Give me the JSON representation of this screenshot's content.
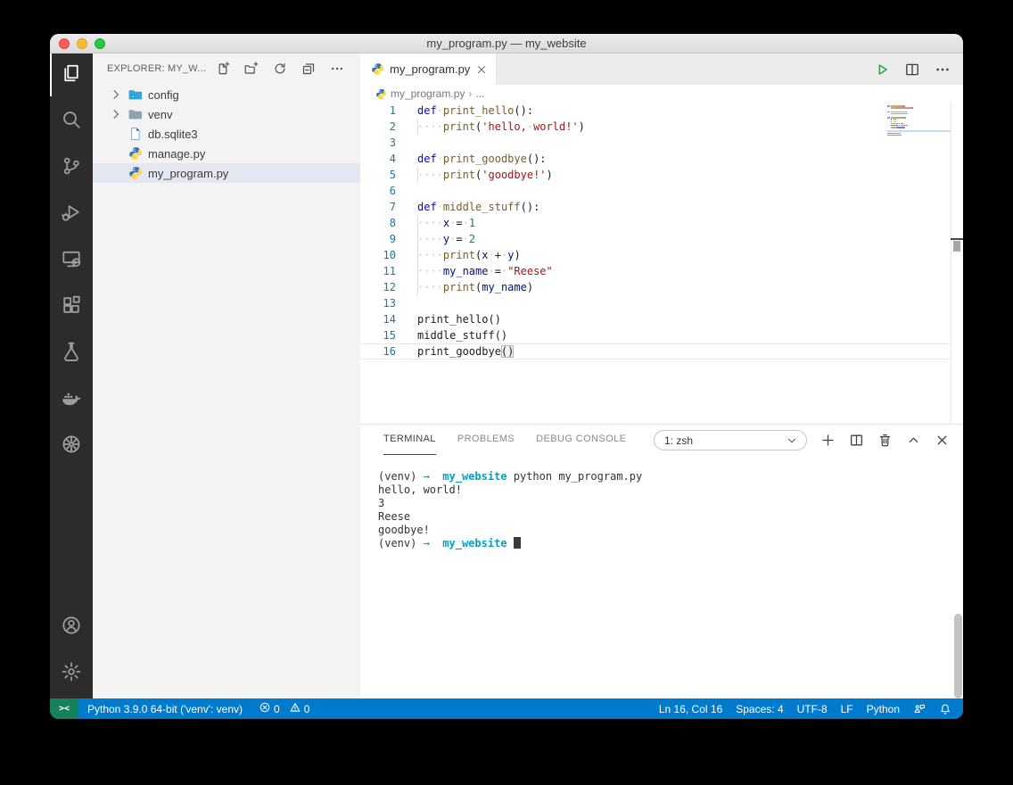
{
  "window": {
    "title": "my_program.py — my_website"
  },
  "colors": {
    "accent": "#007ACC",
    "remote": "#16825D",
    "kw": "#0000FF",
    "fn": "#795E26",
    "st": "#A31515",
    "nm": "#098658",
    "vr": "#001080",
    "line-number": "#237893",
    "tdir": "#00A2C7",
    "tarrow": "#23A923"
  },
  "activity_bar": {
    "top": [
      {
        "name": "explorer",
        "icon": "files",
        "active": true
      },
      {
        "name": "search",
        "icon": "search"
      },
      {
        "name": "source-control",
        "icon": "source-control"
      },
      {
        "name": "run-debug",
        "icon": "run-debug"
      },
      {
        "name": "remote-explorer",
        "icon": "remote-explorer"
      },
      {
        "name": "extensions",
        "icon": "extensions"
      },
      {
        "name": "testing",
        "icon": "testing"
      },
      {
        "name": "docker",
        "icon": "docker"
      },
      {
        "name": "kubernetes",
        "icon": "kubernetes"
      }
    ],
    "bottom": [
      {
        "name": "account",
        "icon": "account"
      },
      {
        "name": "settings",
        "icon": "settings"
      }
    ]
  },
  "sidebar": {
    "header": "EXPLORER: MY_W...",
    "actions": [
      {
        "name": "new-file",
        "icon": "new-file"
      },
      {
        "name": "new-folder",
        "icon": "new-folder"
      },
      {
        "name": "refresh-explorer",
        "icon": "refresh"
      },
      {
        "name": "collapse-folders",
        "icon": "collapse-all"
      },
      {
        "name": "more-actions",
        "icon": "more"
      }
    ],
    "files": [
      {
        "label": "config",
        "icon": "folder-config",
        "chevron": true
      },
      {
        "label": "venv",
        "icon": "folder",
        "chevron": true
      },
      {
        "label": "db.sqlite3",
        "icon": "file-db",
        "chevron": false
      },
      {
        "label": "manage.py",
        "icon": "python",
        "chevron": false
      },
      {
        "label": "my_program.py",
        "icon": "python",
        "chevron": false,
        "selected": true
      }
    ]
  },
  "editor": {
    "tab": {
      "label": "my_program.py"
    },
    "actions": [
      {
        "name": "run-python-file",
        "icon": "run",
        "cls": "run"
      },
      {
        "name": "split-editor",
        "icon": "split",
        "cls": ""
      },
      {
        "name": "more-actions",
        "icon": "more",
        "cls": ""
      }
    ],
    "breadcrumb": {
      "file": "my_program.py",
      "separator": "›",
      "more": "..."
    },
    "code": {
      "lines": [
        {
          "num": "1",
          "tokens": [
            [
              "kw",
              "def"
            ],
            [
              "ws",
              " "
            ],
            [
              "fn",
              "print_hello"
            ],
            [
              "pn",
              "():"
            ]
          ]
        },
        {
          "num": "2",
          "indent": true,
          "tokens": [
            [
              "ws",
              "    "
            ],
            [
              "fn",
              "print"
            ],
            [
              "pn",
              "("
            ],
            [
              "st",
              "'hello, world!'"
            ],
            [
              "pn",
              ")"
            ]
          ]
        },
        {
          "num": "3",
          "tokens": []
        },
        {
          "num": "4",
          "tokens": [
            [
              "kw",
              "def"
            ],
            [
              "ws",
              " "
            ],
            [
              "fn",
              "print_goodbye"
            ],
            [
              "pn",
              "():"
            ]
          ]
        },
        {
          "num": "5",
          "indent": true,
          "tokens": [
            [
              "ws",
              "    "
            ],
            [
              "fn",
              "print"
            ],
            [
              "pn",
              "("
            ],
            [
              "st",
              "'goodbye!'"
            ],
            [
              "pn",
              ")"
            ]
          ]
        },
        {
          "num": "6",
          "tokens": []
        },
        {
          "num": "7",
          "tokens": [
            [
              "kw",
              "def"
            ],
            [
              "ws",
              " "
            ],
            [
              "fn",
              "middle_stuff"
            ],
            [
              "pn",
              "():"
            ]
          ]
        },
        {
          "num": "8",
          "indent": true,
          "tokens": [
            [
              "ws",
              "    "
            ],
            [
              "vr",
              "x"
            ],
            [
              "ws",
              " "
            ],
            [
              "pn",
              "="
            ],
            [
              "ws",
              " "
            ],
            [
              "nm",
              "1"
            ]
          ]
        },
        {
          "num": "9",
          "indent": true,
          "tokens": [
            [
              "ws",
              "    "
            ],
            [
              "vr",
              "y"
            ],
            [
              "ws",
              " "
            ],
            [
              "pn",
              "="
            ],
            [
              "ws",
              " "
            ],
            [
              "nm",
              "2"
            ]
          ]
        },
        {
          "num": "10",
          "indent": true,
          "tokens": [
            [
              "ws",
              "    "
            ],
            [
              "fn",
              "print"
            ],
            [
              "pn",
              "("
            ],
            [
              "vr",
              "x"
            ],
            [
              "ws",
              " "
            ],
            [
              "pn",
              "+"
            ],
            [
              "ws",
              " "
            ],
            [
              "vr",
              "y"
            ],
            [
              "pn",
              ")"
            ]
          ]
        },
        {
          "num": "11",
          "indent": true,
          "tokens": [
            [
              "ws",
              "    "
            ],
            [
              "vr",
              "my_name"
            ],
            [
              "ws",
              " "
            ],
            [
              "pn",
              "="
            ],
            [
              "ws",
              " "
            ],
            [
              "st",
              "\"Reese\""
            ]
          ]
        },
        {
          "num": "12",
          "indent": true,
          "tokens": [
            [
              "ws",
              "    "
            ],
            [
              "fn",
              "print"
            ],
            [
              "pn",
              "("
            ],
            [
              "vr",
              "my_name"
            ],
            [
              "pn",
              ")"
            ]
          ]
        },
        {
          "num": "13",
          "tokens": []
        },
        {
          "num": "14",
          "tokens": [
            [
              "pl",
              "print_hello"
            ],
            [
              "pn",
              "()"
            ]
          ]
        },
        {
          "num": "15",
          "tokens": [
            [
              "pl",
              "middle_stuff"
            ],
            [
              "pn",
              "()"
            ]
          ]
        },
        {
          "num": "16",
          "current": true,
          "tokens": [
            [
              "pl",
              "print_goodbye"
            ],
            [
              "br",
              "()"
            ]
          ]
        }
      ]
    }
  },
  "panel": {
    "tabs": [
      {
        "label": "TERMINAL",
        "active": true
      },
      {
        "label": "PROBLEMS",
        "active": false
      },
      {
        "label": "DEBUG CONSOLE",
        "active": false
      }
    ],
    "terminal_select": "1: zsh",
    "actions": [
      {
        "name": "new-terminal",
        "icon": "plus"
      },
      {
        "name": "split-terminal",
        "icon": "split"
      },
      {
        "name": "kill-terminal",
        "icon": "trash"
      },
      {
        "name": "maximize-panel",
        "icon": "chev-up"
      },
      {
        "name": "close-panel",
        "icon": "close"
      }
    ],
    "terminal_lines": [
      [
        [
          "p",
          "(venv) "
        ],
        [
          "ar",
          "→"
        ],
        [
          "p",
          "  "
        ],
        [
          "dir",
          "my_website"
        ],
        [
          "p",
          " python my_program.py"
        ]
      ],
      [
        [
          "p",
          "hello, world!"
        ]
      ],
      [
        [
          "p",
          "3"
        ]
      ],
      [
        [
          "p",
          "Reese"
        ]
      ],
      [
        [
          "p",
          "goodbye!"
        ]
      ],
      [
        [
          "p",
          "(venv) "
        ],
        [
          "ar",
          "→"
        ],
        [
          "p",
          "  "
        ],
        [
          "dir",
          "my_website"
        ],
        [
          "p",
          " "
        ],
        [
          "cur",
          " "
        ]
      ]
    ]
  },
  "status_bar": {
    "remote_glyph": "><",
    "python_version": "Python 3.9.0 64-bit ('venv': venv)",
    "errors": "0",
    "warnings": "0",
    "line_col": "Ln 16, Col 16",
    "indentation": "Spaces: 4",
    "encoding": "UTF-8",
    "eol": "LF",
    "language": "Python"
  }
}
